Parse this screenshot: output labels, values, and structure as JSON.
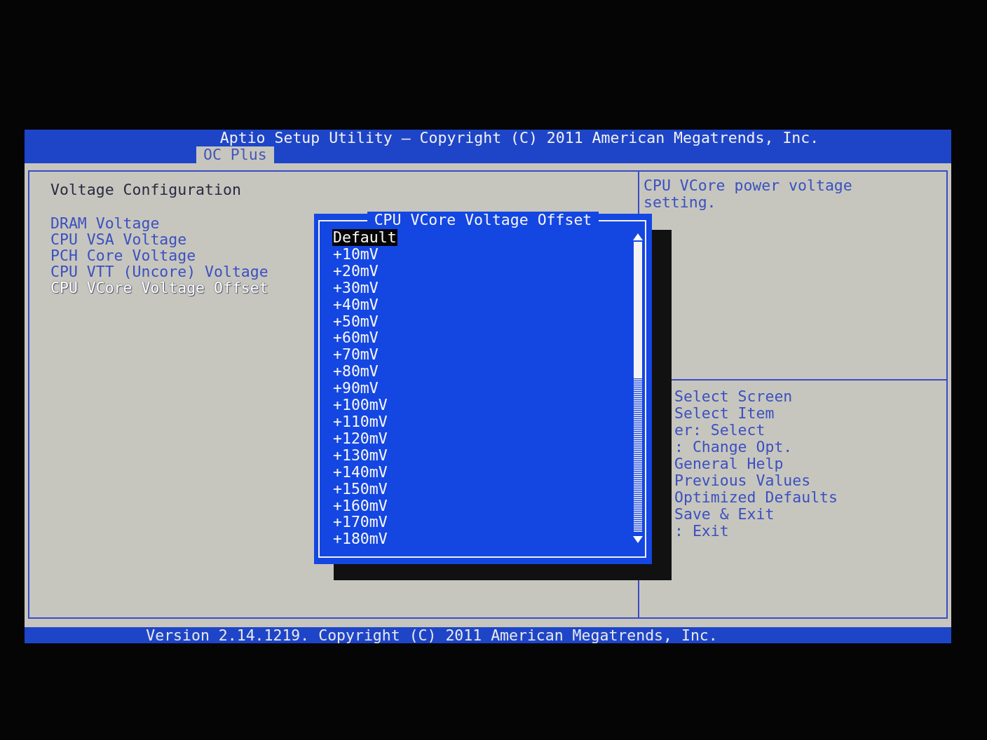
{
  "header": {
    "title": "Aptio Setup Utility – Copyright (C) 2011 American Megatrends, Inc.",
    "tabs": [
      {
        "label": "OC Plus",
        "selected": true
      }
    ]
  },
  "left_panel": {
    "heading": "Voltage Configuration",
    "items": [
      {
        "label": "DRAM Voltage",
        "selected": false
      },
      {
        "label": "CPU VSA Voltage",
        "selected": false
      },
      {
        "label": "PCH Core Voltage",
        "selected": false
      },
      {
        "label": "CPU VTT (Uncore) Voltage",
        "selected": false
      },
      {
        "label": "CPU VCore Voltage Offset",
        "selected": true
      }
    ]
  },
  "help_panel": {
    "description": "CPU VCore power voltage setting.",
    "keys": [
      "Select Screen",
      "Select Item",
      "er: Select",
      ": Change Opt.",
      "General Help",
      "Previous Values",
      "Optimized Defaults",
      "Save & Exit",
      ": Exit"
    ]
  },
  "popup": {
    "title": "CPU VCore Voltage Offset",
    "options": [
      {
        "label": "Default",
        "selected": true
      },
      {
        "label": "+10mV",
        "selected": false
      },
      {
        "label": "+20mV",
        "selected": false
      },
      {
        "label": "+30mV",
        "selected": false
      },
      {
        "label": "+40mV",
        "selected": false
      },
      {
        "label": "+50mV",
        "selected": false
      },
      {
        "label": "+60mV",
        "selected": false
      },
      {
        "label": "+70mV",
        "selected": false
      },
      {
        "label": "+80mV",
        "selected": false
      },
      {
        "label": "+90mV",
        "selected": false
      },
      {
        "label": "+100mV",
        "selected": false
      },
      {
        "label": "+110mV",
        "selected": false
      },
      {
        "label": "+120mV",
        "selected": false
      },
      {
        "label": "+130mV",
        "selected": false
      },
      {
        "label": "+140mV",
        "selected": false
      },
      {
        "label": "+150mV",
        "selected": false
      },
      {
        "label": "+160mV",
        "selected": false
      },
      {
        "label": "+170mV",
        "selected": false
      },
      {
        "label": "+180mV",
        "selected": false
      }
    ]
  },
  "status_bar": "Version 2.14.1219. Copyright (C) 2011 American Megatrends, Inc."
}
